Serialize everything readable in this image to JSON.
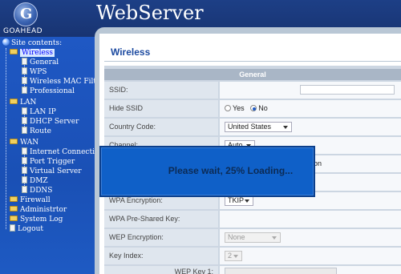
{
  "header": {
    "logo_text": "GoAhead",
    "logo_glyph": "G",
    "title": "WebServer"
  },
  "sidebar": {
    "root_label": "Site contents:",
    "groups": [
      {
        "label": "Wireless",
        "items": [
          "General",
          "WPS",
          "Wireless MAC Filter",
          "Professional"
        ]
      },
      {
        "label": "LAN",
        "items": [
          "LAN IP",
          "DHCP Server",
          "Route"
        ]
      },
      {
        "label": "WAN",
        "items": [
          "Internet Connection",
          "Port Trigger",
          "Virtual Server",
          "DMZ",
          "DDNS"
        ]
      }
    ],
    "links": [
      "Firewall",
      "Administrtor",
      "System Log",
      "Logout"
    ]
  },
  "content": {
    "section_title": "Wireless",
    "table_header": "General",
    "rows": {
      "ssid": {
        "label": "SSID:"
      },
      "hide_ssid": {
        "label": "Hide SSID",
        "opt_yes": "Yes",
        "opt_no": "No",
        "selected": "No"
      },
      "country": {
        "label": "Country Code:",
        "value": "United States"
      },
      "channel": {
        "label": "Channel:",
        "value": "Auto"
      },
      "wpa_encryption": {
        "label": "WPA Encryption:",
        "value": "TKIP"
      },
      "wpa_key": {
        "label": "WPA Pre-Shared Key:"
      },
      "wep_encryption": {
        "label": "WEP Encryption:",
        "value": "None"
      },
      "key_index": {
        "label": "Key Index:",
        "value": "2"
      },
      "wep_key1": {
        "label": "WEP Key 1:"
      }
    },
    "partial_text": "ction"
  },
  "overlay": {
    "message": "Please wait, 25% Loading..."
  },
  "colors": {
    "header_bg": "#183472",
    "sidebar_bg": "#1f58c4",
    "overlay_bg": "#0f60c8",
    "title": "#1c4aa0"
  }
}
